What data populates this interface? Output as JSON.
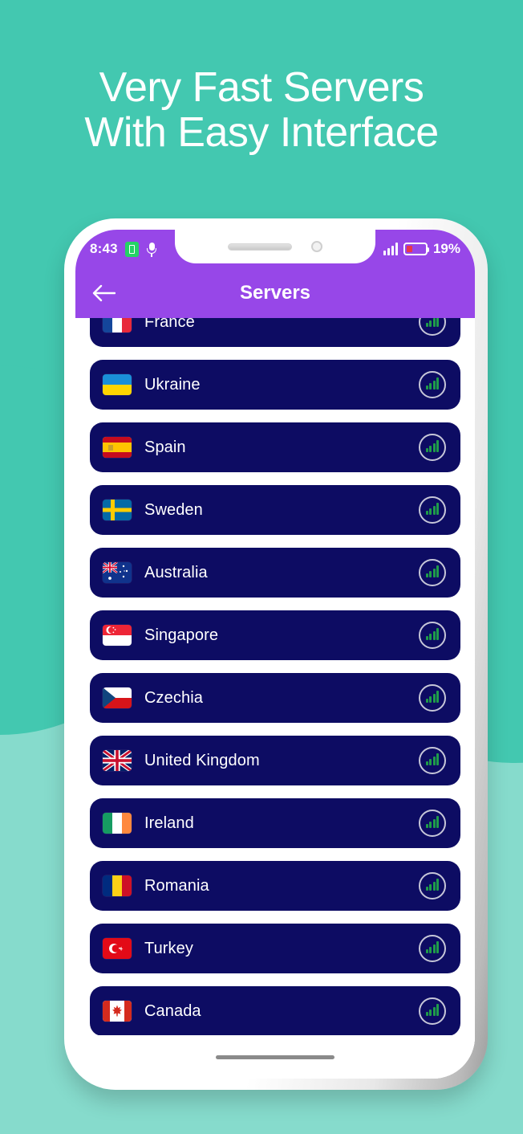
{
  "promo": {
    "headline_line1": "Very Fast Servers",
    "headline_line2": "With Easy Interface",
    "background_color": "#43c8b0",
    "background_accent_color": "#86dbcc",
    "text_color": "#ffffff"
  },
  "status_bar": {
    "time": "8:43",
    "battery_percent": "19%",
    "background_color": "#9747e8",
    "icons": [
      "battery-saver-icon",
      "microphone-icon",
      "signal-bars-icon",
      "battery-low-icon"
    ]
  },
  "app_bar": {
    "title": "Servers",
    "back_label": "Back",
    "background_color": "#9747e8"
  },
  "server_list": {
    "row_color": "#0d0c63",
    "signal_color": "#1f9c4a",
    "items": [
      {
        "name": "France",
        "flag": "flag-fr",
        "signal": "signal-bars-icon"
      },
      {
        "name": "Ukraine",
        "flag": "flag-ua",
        "signal": "signal-bars-icon"
      },
      {
        "name": "Spain",
        "flag": "flag-es",
        "signal": "signal-bars-icon"
      },
      {
        "name": "Sweden",
        "flag": "flag-se",
        "signal": "signal-bars-icon"
      },
      {
        "name": "Australia",
        "flag": "flag-au",
        "signal": "signal-bars-icon"
      },
      {
        "name": "Singapore",
        "flag": "flag-sg",
        "signal": "signal-bars-icon"
      },
      {
        "name": "Czechia",
        "flag": "flag-cz",
        "signal": "signal-bars-icon"
      },
      {
        "name": "United Kingdom",
        "flag": "flag-gb",
        "signal": "signal-bars-icon"
      },
      {
        "name": "Ireland",
        "flag": "flag-ie",
        "signal": "signal-bars-icon"
      },
      {
        "name": "Romania",
        "flag": "flag-ro",
        "signal": "signal-bars-icon"
      },
      {
        "name": "Turkey",
        "flag": "flag-tr",
        "signal": "signal-bars-icon"
      },
      {
        "name": "Canada",
        "flag": "flag-ca",
        "signal": "signal-bars-icon"
      }
    ]
  }
}
